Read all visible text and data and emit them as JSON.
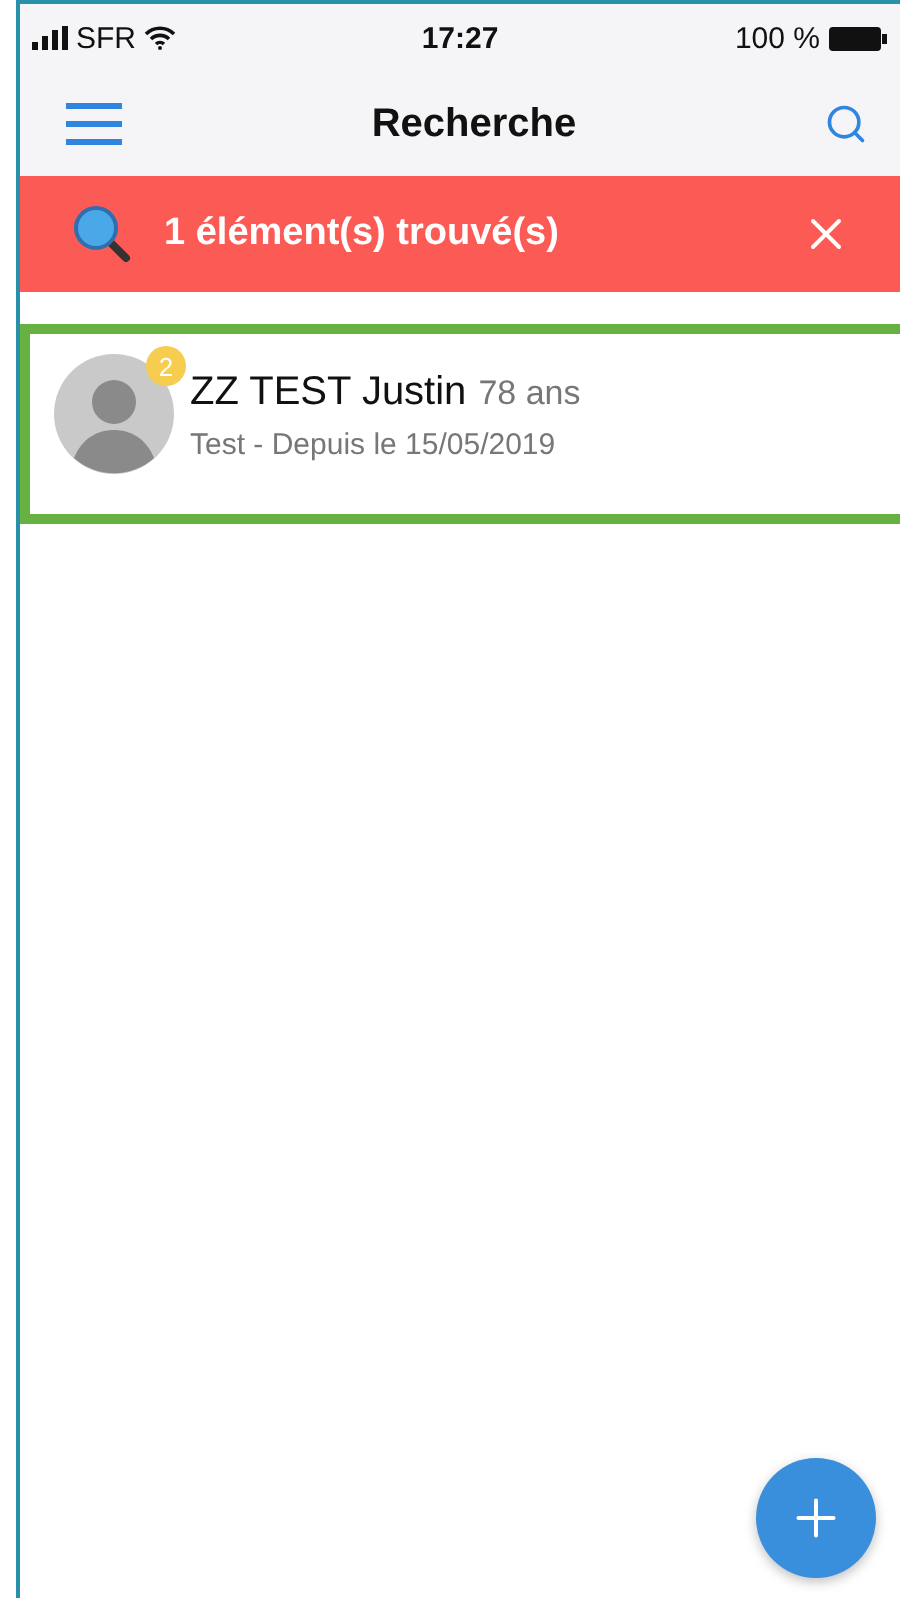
{
  "status_bar": {
    "carrier": "SFR",
    "time": "17:27",
    "battery": "100 %"
  },
  "nav": {
    "title": "Recherche"
  },
  "results_banner": {
    "text": "1 élément(s) trouvé(s)"
  },
  "results": [
    {
      "name": "ZZ TEST Justin",
      "age": "78 ans",
      "subtitle": "Test - Depuis le 15/05/2019",
      "badge": "2",
      "highlighted": true
    }
  ]
}
